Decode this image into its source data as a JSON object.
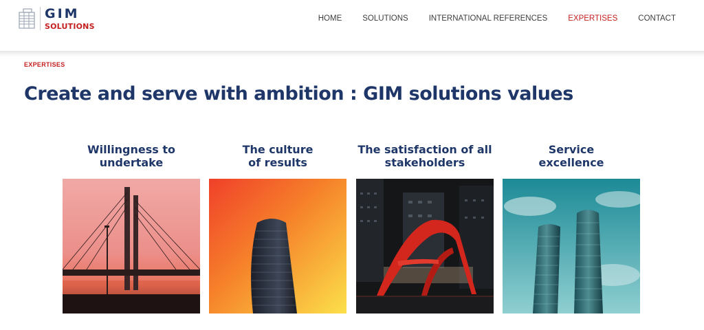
{
  "logo": {
    "line1": "GIM",
    "line2": "SOLUTIONS"
  },
  "nav": [
    {
      "label": "HOME"
    },
    {
      "label": "SOLUTIONS"
    },
    {
      "label": "INTERNATIONAL REFERENCES"
    },
    {
      "label": "EXPERTISES",
      "active": true
    },
    {
      "label": "CONTACT"
    }
  ],
  "breadcrumb": "EXPERTISES",
  "title": "Create and serve with ambition : GIM solutions values",
  "cards": [
    {
      "title": "Willingness to\nundertake",
      "image": "bridge-sunset-photo"
    },
    {
      "title": "The culture\nof results",
      "image": "curved-tower-photo"
    },
    {
      "title": "The satisfaction of all\nstakeholders",
      "image": "red-sculpture-night-photo"
    },
    {
      "title": "Service\nexcellence",
      "image": "twin-towers-sky-photo"
    }
  ],
  "colors": {
    "navy": "#1f3768",
    "red": "#c41f1f"
  }
}
